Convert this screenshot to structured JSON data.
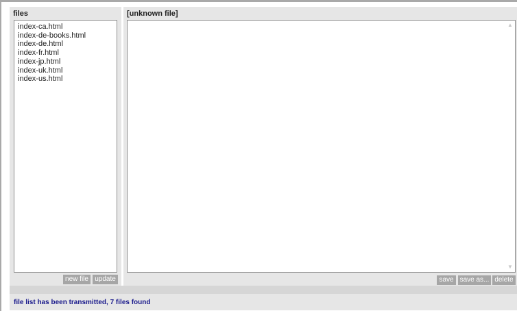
{
  "files_panel": {
    "title": "files",
    "items": [
      "index-ca.html",
      "index-de-books.html",
      "index-de.html",
      "index-fr.html",
      "index-jp.html",
      "index-uk.html",
      "index-us.html"
    ],
    "new_file_label": "new file",
    "update_label": "update"
  },
  "editor_panel": {
    "title": "[unknown file]",
    "content": "",
    "save_label": "save",
    "save_as_label": "save as...",
    "delete_label": "delete"
  },
  "status": {
    "message": "file list has been transmitted, 7 files found"
  },
  "icons": {
    "scroll_up": "triangle-up",
    "scroll_down": "triangle-down"
  },
  "colors": {
    "panel_bg": "#e6e6e6",
    "button_bg": "#a6a6a6",
    "status_text": "#1a1a8c"
  }
}
